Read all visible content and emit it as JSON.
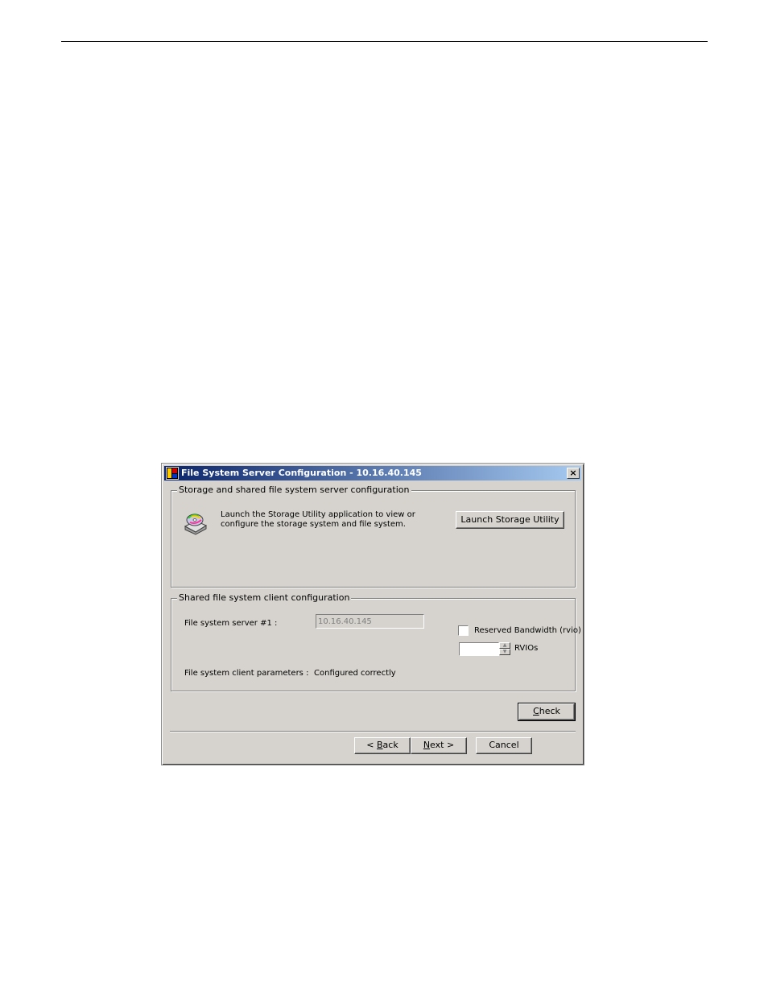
{
  "dialog": {
    "title": "File System Server Configuration - 10.16.40.145",
    "close_label": "×"
  },
  "storage_group": {
    "label": "Storage and shared file system server configuration",
    "description": "Launch the Storage Utility application to view or configure the storage system and file system.",
    "launch_button": "Launch Storage Utility",
    "icon": "storage-disk-icon"
  },
  "client_group": {
    "label": "Shared file system client configuration",
    "server_label": "File system server #1 :",
    "server_value": "10.16.40.145",
    "reserved_bandwidth_label": "Reserved Bandwidth (rvio)",
    "reserved_bandwidth_checked": false,
    "rvios_value": "",
    "rvios_label": "RVIOs",
    "params_label": "File system client parameters :",
    "params_value": "Configured correctly"
  },
  "buttons": {
    "check_prefix": "",
    "check_underline": "C",
    "check_rest": "heck",
    "back_prefix": "< ",
    "back_underline": "B",
    "back_rest": "ack",
    "next_underline": "N",
    "next_rest": "ext >",
    "cancel": "Cancel"
  }
}
